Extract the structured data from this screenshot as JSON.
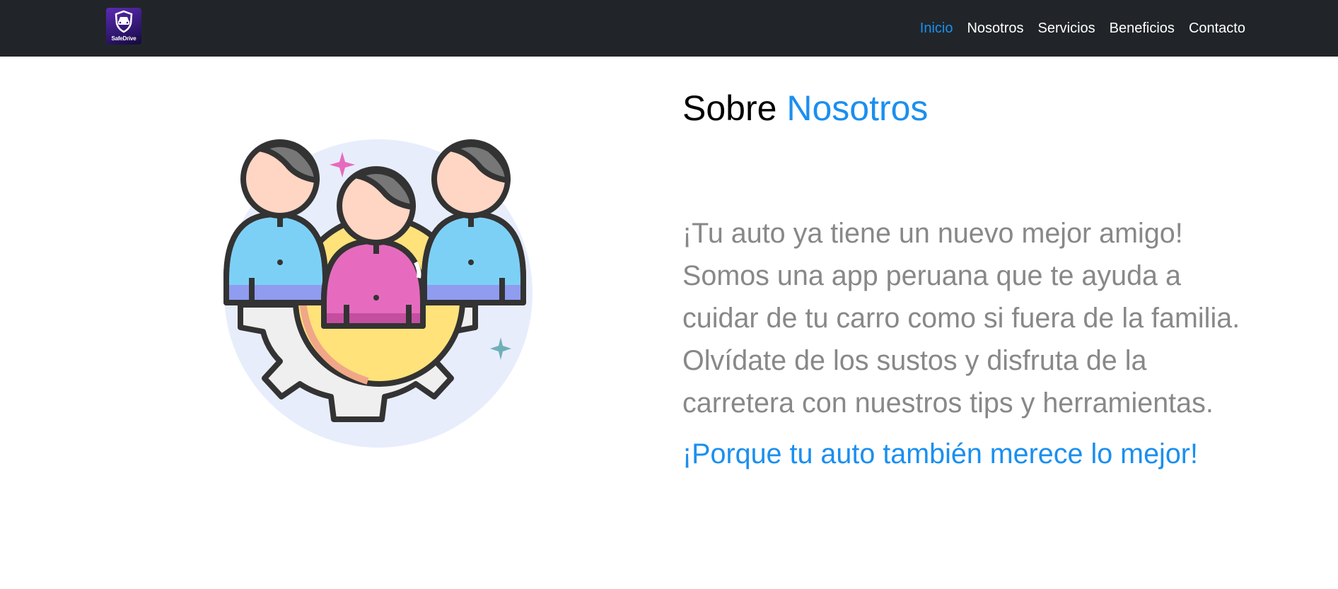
{
  "brand": {
    "logo_text": "SafeDrive"
  },
  "nav": {
    "items": [
      {
        "label": "Inicio",
        "active": true
      },
      {
        "label": "Nosotros",
        "active": false
      },
      {
        "label": "Servicios",
        "active": false
      },
      {
        "label": "Beneficios",
        "active": false
      },
      {
        "label": "Contacto",
        "active": false
      }
    ]
  },
  "about": {
    "title_main": "Sobre",
    "title_accent": "Nosotros",
    "description_lines": [
      "¡Tu auto ya tiene un nuevo mejor amigo!",
      "Somos una app peruana que te ayuda a",
      "cuidar de tu carro como si fuera de la familia.",
      "Olvídate de los sustos y disfruta de la",
      "carretera con nuestros tips y herramientas."
    ],
    "tagline": "¡Porque tu auto también merece lo mejor!"
  },
  "icons": {
    "logo": "shield-car-icon",
    "illustration": "team-gear-illustration"
  },
  "colors": {
    "navbar": "#212529",
    "accent": "#1a8ff0",
    "body_text": "#888888"
  }
}
